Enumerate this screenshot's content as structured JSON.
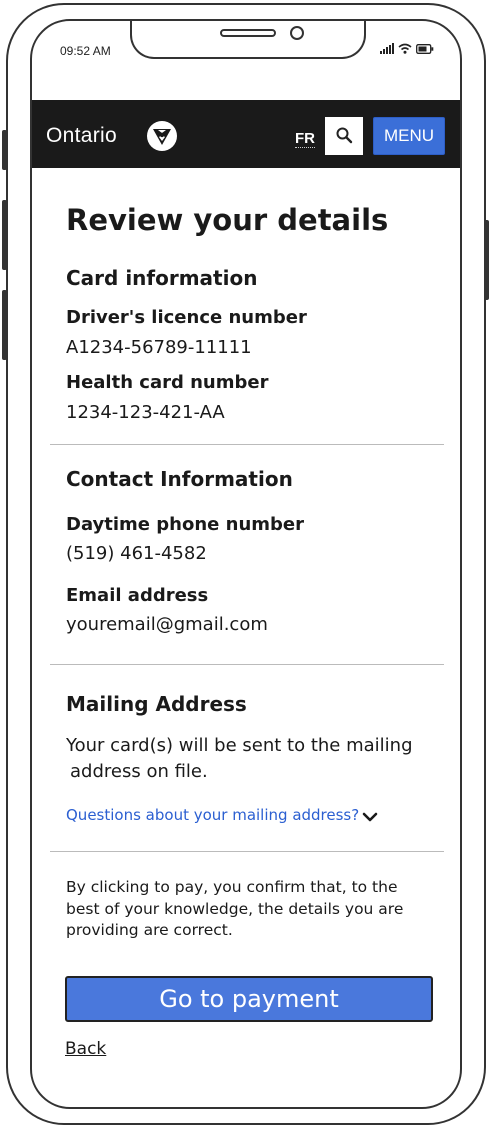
{
  "status_bar": {
    "time": "09:52 AM"
  },
  "header": {
    "brand": "Ontario",
    "lang_toggle": "FR",
    "menu_label": "MENU",
    "brand_icon": "trillium-logo",
    "search_icon": "search-icon"
  },
  "page": {
    "title": "Review your details",
    "card_section": {
      "heading": "Card information",
      "fields": [
        {
          "label": "Driver's licence number",
          "value": "A1234-56789-11111"
        },
        {
          "label": "Health card number",
          "value": "1234-123-421-AA"
        }
      ]
    },
    "contact_section": {
      "heading": "Contact Information",
      "fields": [
        {
          "label": "Daytime phone number",
          "value": "(519) 461-4582"
        },
        {
          "label": "Email address",
          "value": "youremail@gmail.com"
        }
      ]
    },
    "mailing_section": {
      "heading": "Mailing Address",
      "text_line1": "Your card(s) will be sent to the mailing",
      "text_line2": "address on file.",
      "questions_link": "Questions about your mailing address?"
    },
    "confirmation_text": {
      "line1": "By clicking to pay, you confirm that, to the",
      "line2": "best of your knowledge, the details you are",
      "line3": "providing are correct."
    },
    "payment_button": "Go to payment",
    "back_link": "Back"
  },
  "colors": {
    "header_bg": "#1a1a1a",
    "menu_button": "#3b6fd8",
    "primary_button": "#4a78dc",
    "link": "#2b5fd1"
  }
}
